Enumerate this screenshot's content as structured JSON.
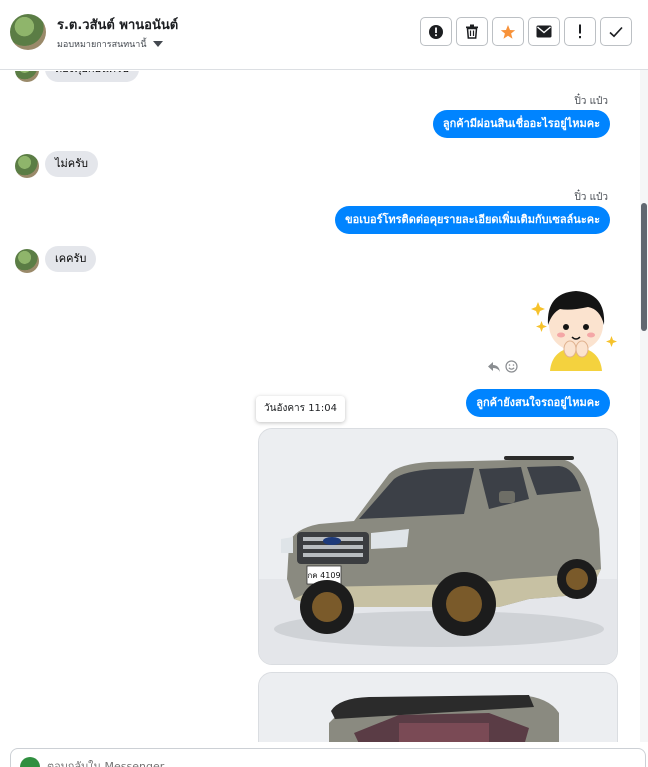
{
  "header": {
    "contact_name": "ร.ต.วสันต์ พานอนันต์",
    "assign_label": "มอบหมายการสนทนานี้",
    "actions": [
      {
        "icon": "alert-circle-icon",
        "name": "mark-spam-button"
      },
      {
        "icon": "trash-icon",
        "name": "delete-button"
      },
      {
        "icon": "star-icon",
        "name": "star-button"
      },
      {
        "icon": "envelope-icon",
        "name": "mark-unread-button"
      },
      {
        "icon": "exclamation-icon",
        "name": "flag-button"
      },
      {
        "icon": "check-icon",
        "name": "done-button"
      }
    ],
    "star_color": "#f7923a"
  },
  "messages": {
    "m0_in_partial": "ต้องคุยก่อนครับ",
    "m1_sender": "ปิ๋ว แป๋ว",
    "m1_out": "ลูกค้ามีผ่อนสินเชื่ออะไรอยู่ไหมคะ",
    "m2_in": "ไม่ครับ",
    "m3_sender": "ปิ๋ว แป๋ว",
    "m3_out": "ขอเบอร์โทรติดต่อคุยรายละเอียดเพิ่มเติมกับเซลล์นะคะ",
    "m4_in": "เคครับ",
    "m5_out": "ลูกค้ายังสนใจรถอยู่ไหมคะ",
    "time_tooltip": "วันอังคาร 11:04",
    "plate_text": "กค 4109"
  },
  "colors": {
    "outgoing_bubble": "#0084ff",
    "incoming_bubble": "#e4e6eb"
  },
  "composer": {
    "placeholder": "ตอบกลับใน Messenger..."
  }
}
